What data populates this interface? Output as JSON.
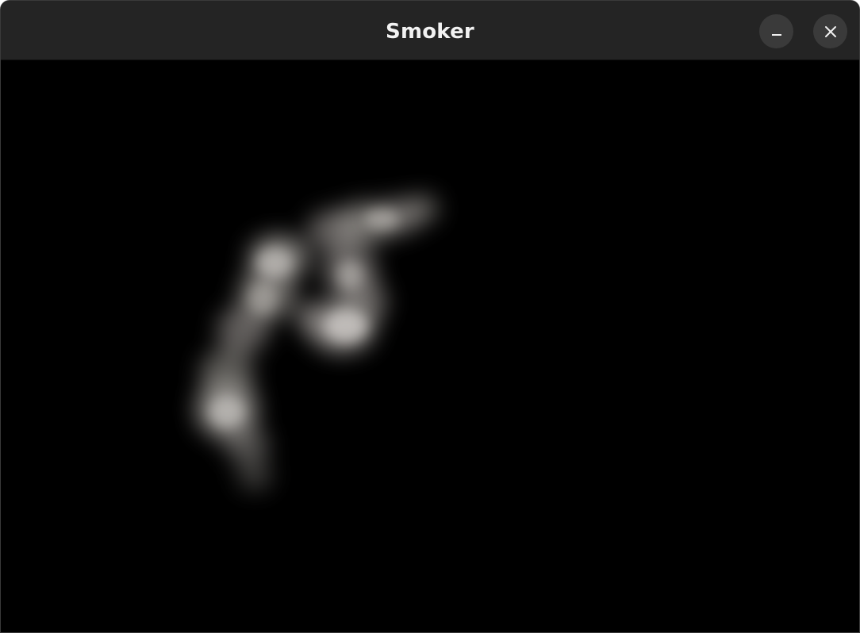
{
  "window": {
    "title": "Smoker"
  },
  "controls": {
    "minimize_icon": "minimize-icon",
    "close_icon": "close-icon"
  },
  "colors": {
    "titlebar": "#242424",
    "button": "#3a3a3a",
    "canvas": "#000000",
    "smoke": "#c8c4c0"
  }
}
